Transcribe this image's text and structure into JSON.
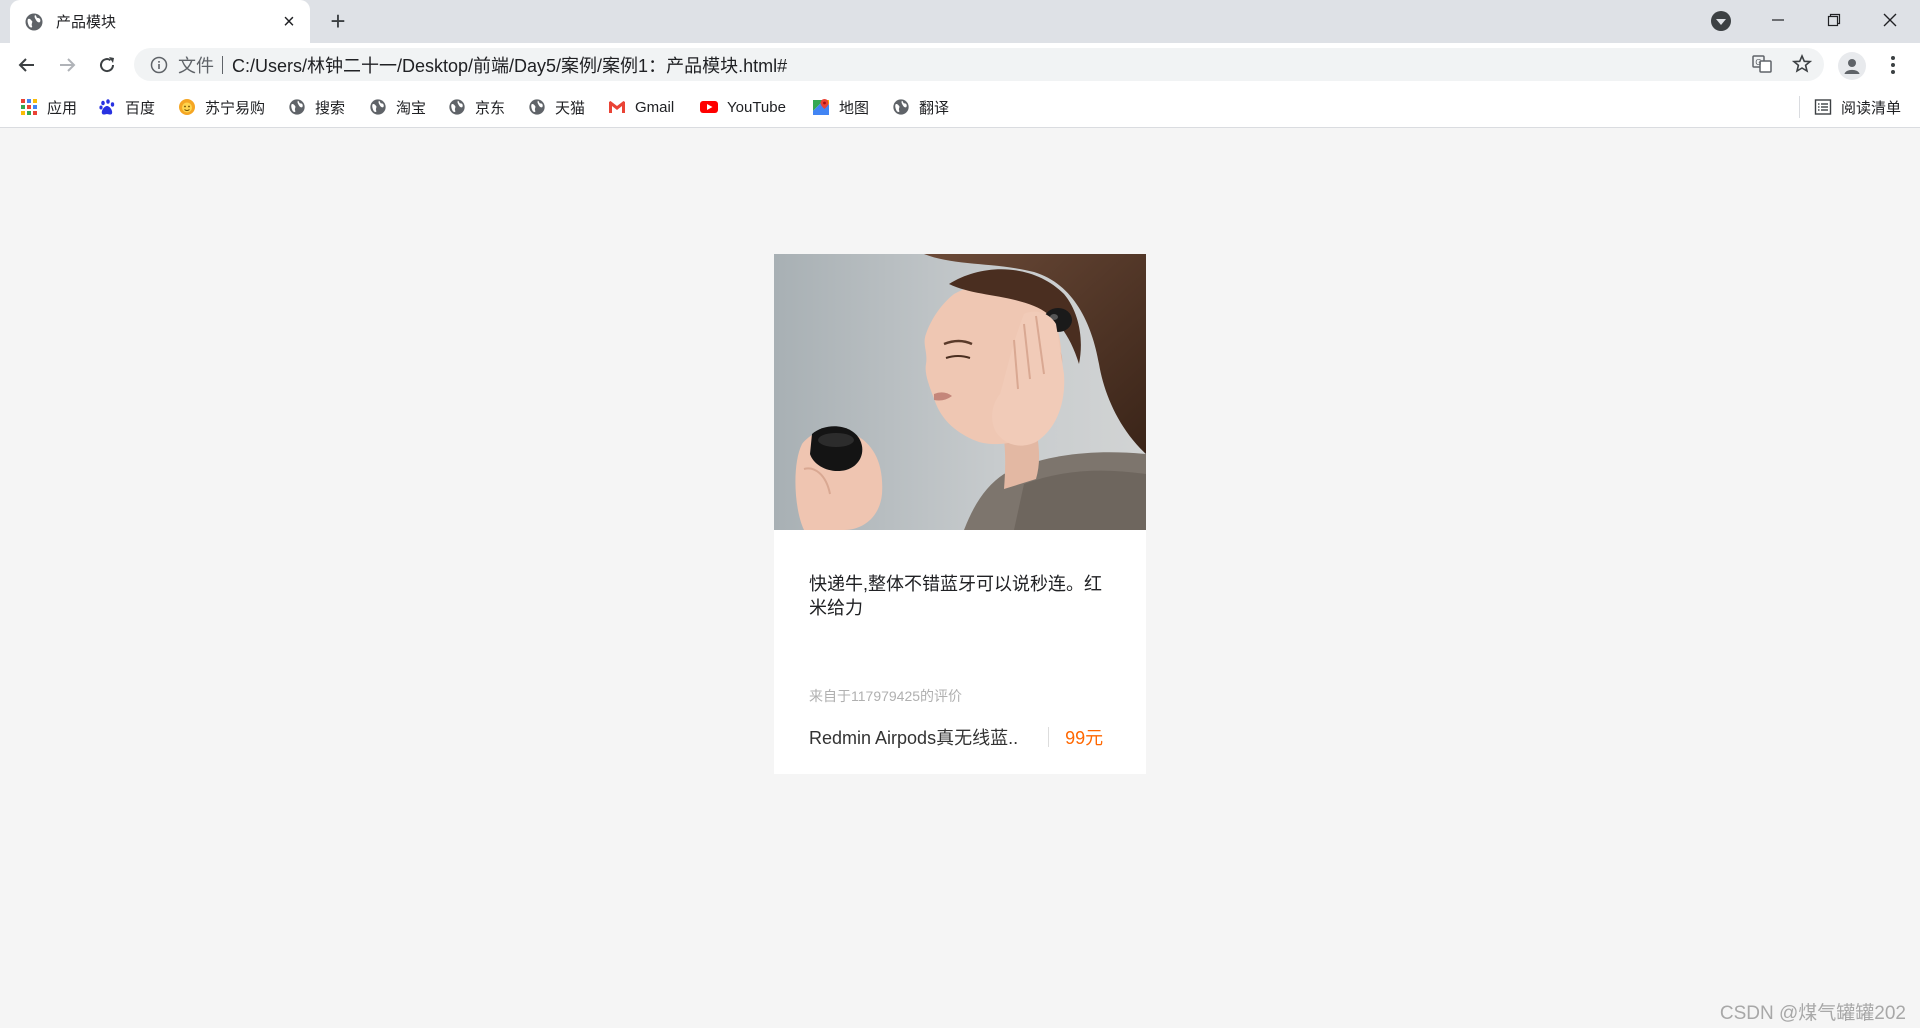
{
  "browser": {
    "tab": {
      "title": "产品模块"
    },
    "address_bar": {
      "scheme_label": "文件",
      "url": "C:/Users/林钟二十一/Desktop/前端/Day5/案例/案例1：产品模块.html#"
    },
    "bookmarks": [
      {
        "label": "应用",
        "icon": "apps-grid-icon"
      },
      {
        "label": "百度",
        "icon": "baidu-paw-icon"
      },
      {
        "label": "苏宁易购",
        "icon": "suning-lion-icon"
      },
      {
        "label": "搜索",
        "icon": "globe-icon"
      },
      {
        "label": "淘宝",
        "icon": "globe-icon"
      },
      {
        "label": "京东",
        "icon": "globe-icon"
      },
      {
        "label": "天猫",
        "icon": "globe-icon"
      },
      {
        "label": "Gmail",
        "icon": "gmail-icon"
      },
      {
        "label": "YouTube",
        "icon": "youtube-icon"
      },
      {
        "label": "地图",
        "icon": "maps-icon"
      },
      {
        "label": "翻译",
        "icon": "globe-icon"
      }
    ],
    "reading_list": {
      "label": "阅读清单",
      "icon": "reading-list-icon"
    }
  },
  "product_card": {
    "image_alt": "woman-wearing-wireless-earbud-photo",
    "review_text": "快递牛,整体不错蓝牙可以说秒连。红米给力",
    "reviewer": "来自于117979425的评价",
    "product_name": "Redmin Airpods真无线蓝..",
    "price": "99元"
  },
  "watermark": "CSDN @煤气罐罐202",
  "colors": {
    "page_background": "#f5f5f5",
    "price_accent": "#ff6700",
    "tabstrip": "#dee1e6"
  }
}
